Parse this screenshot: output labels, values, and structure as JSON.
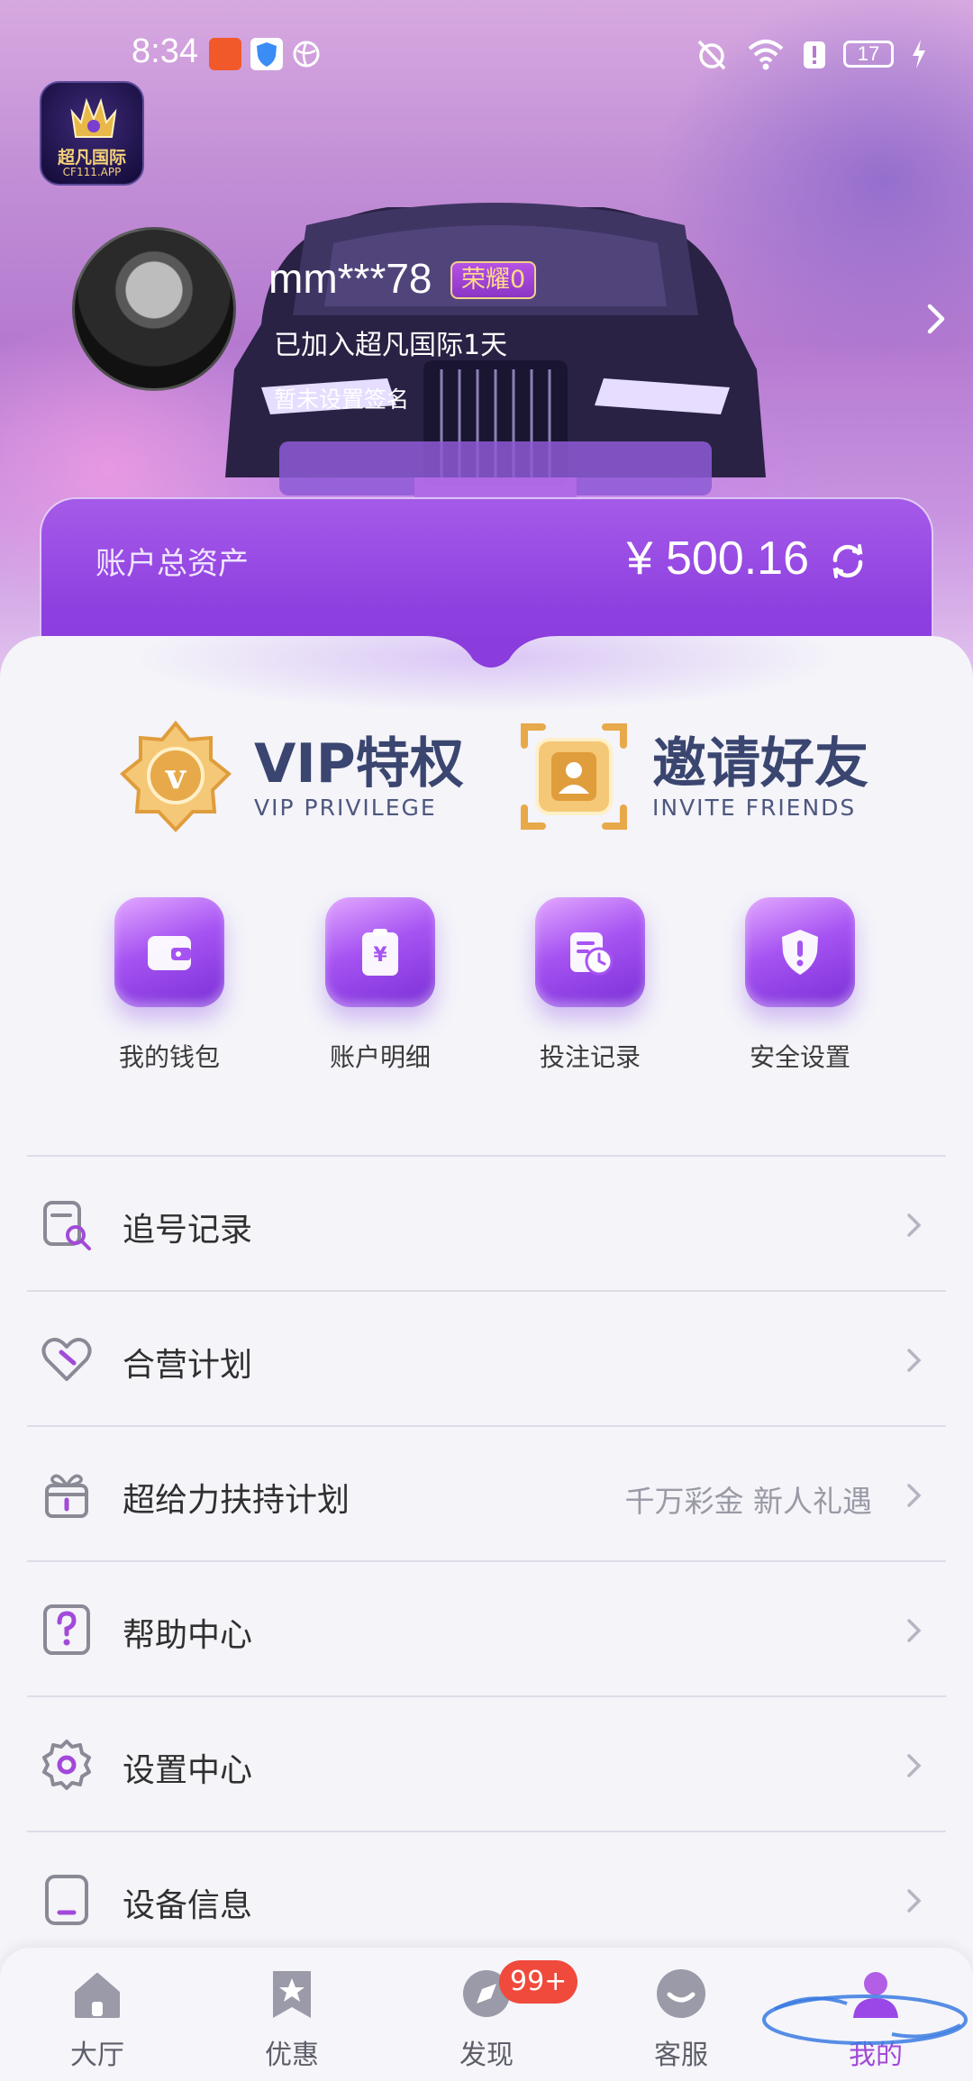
{
  "status_bar": {
    "time": "8:34",
    "battery": "17"
  },
  "app": {
    "logo_name": "超凡国际",
    "logo_url": "CF111.APP"
  },
  "profile": {
    "username": "mm***78",
    "rank_badge": "荣耀0",
    "join_days": "已加入超凡国际1天",
    "signature": "暂未设置签名"
  },
  "assets": {
    "label": "账户总资产",
    "value": "¥ 500.16"
  },
  "promos": [
    {
      "title": "VIP特权",
      "subtitle": "VIP PRIVILEGE"
    },
    {
      "title": "邀请好友",
      "subtitle": "INVITE FRIENDS"
    }
  ],
  "quick_actions": [
    {
      "label": "我的钱包",
      "icon": "wallet-icon"
    },
    {
      "label": "账户明细",
      "icon": "clipboard-yen-icon"
    },
    {
      "label": "投注记录",
      "icon": "document-clock-icon"
    },
    {
      "label": "安全设置",
      "icon": "shield-alert-icon"
    }
  ],
  "menu": [
    {
      "label": "追号记录",
      "extra": "",
      "icon": "search-document-icon"
    },
    {
      "label": "合营计划",
      "extra": "",
      "icon": "heart-handshake-icon"
    },
    {
      "label": "超给力扶持计划",
      "extra": "千万彩金 新人礼遇",
      "icon": "gift-icon"
    },
    {
      "label": "帮助中心",
      "extra": "",
      "icon": "help-icon"
    },
    {
      "label": "设置中心",
      "extra": "",
      "icon": "gear-icon"
    },
    {
      "label": "设备信息",
      "extra": "",
      "icon": "device-icon"
    }
  ],
  "bottom_nav": [
    {
      "label": "大厅",
      "icon": "home-icon"
    },
    {
      "label": "优惠",
      "icon": "star-bookmark-icon"
    },
    {
      "label": "发现",
      "icon": "compass-icon",
      "badge": "99+"
    },
    {
      "label": "客服",
      "icon": "chat-smile-icon"
    },
    {
      "label": "我的",
      "icon": "person-icon",
      "active": true
    }
  ],
  "colors": {
    "accent": "#9b46e6",
    "badge_red": "#ef4a3c",
    "text_dark": "#2f2f2f"
  }
}
